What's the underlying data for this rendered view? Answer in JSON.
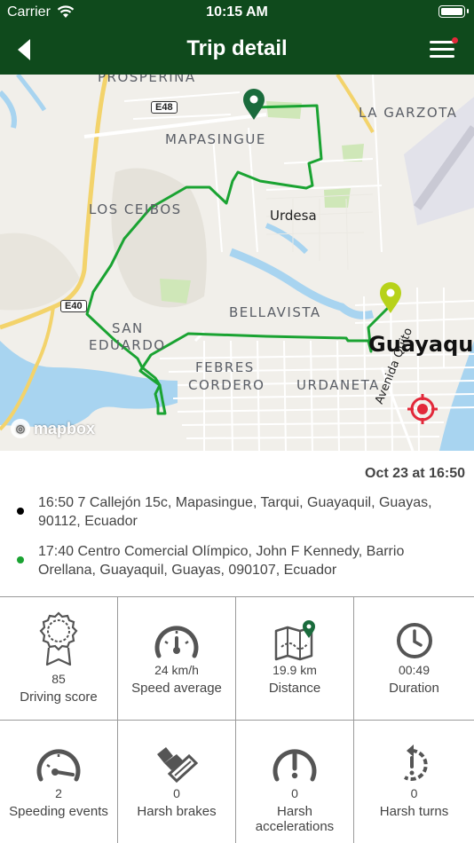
{
  "status_bar": {
    "carrier": "Carrier",
    "time": "10:15 AM"
  },
  "nav": {
    "title": "Trip detail"
  },
  "map": {
    "labels": {
      "prosperina": "PROSPERINA",
      "mapasingue": "MAPASINGUE",
      "la_garzota": "LA GARZOTA",
      "los_ceibos": "LOS CEIBOS",
      "urdesa": "Urdesa",
      "san": "SAN",
      "eduardo": "EDUARDO",
      "bellavista": "BELLAVISTA",
      "guayaquil": "Guayaquil",
      "febres": "FEBRES",
      "cordero": "CORDERO",
      "urdaneta": "URDANETA",
      "avenida_quito": "Avenida Quito"
    },
    "road_badges": {
      "e48": "E48",
      "e40": "E40"
    },
    "attribution": "mapbox",
    "colors": {
      "route": "#1aa332",
      "start_pin": "#1a6b3c",
      "end_pin": "#b7d21a",
      "target": "#e2293a",
      "water": "#a8d4f0"
    }
  },
  "trip": {
    "date": "Oct 23 at 16:50",
    "start": {
      "text": "16:50 7 Callejón 15c, Mapasingue, Tarqui, Guayaquil, Guayas, 90112, Ecuador",
      "dot_color": "#000000"
    },
    "end": {
      "text": "17:40 Centro Comercial Olímpico, John F Kennedy, Barrio Orellana, Guayaquil, Guayas, 090107, Ecuador",
      "dot_color": "#1aa332"
    }
  },
  "stats": [
    {
      "icon": "badge-icon",
      "value": "85",
      "label": "Driving score"
    },
    {
      "icon": "speedometer-icon",
      "value": "24 km/h",
      "label": "Speed average"
    },
    {
      "icon": "map-pin-icon",
      "value": "19.9 km",
      "label": "Distance"
    },
    {
      "icon": "clock-icon",
      "value": "00:49",
      "label": "Duration"
    },
    {
      "icon": "speeding-gauge-icon",
      "value": "2",
      "label": "Speeding events"
    },
    {
      "icon": "brake-pedal-icon",
      "value": "0",
      "label": "Harsh brakes"
    },
    {
      "icon": "acceleration-warning-icon",
      "value": "0",
      "label": "Harsh accelerations"
    },
    {
      "icon": "turn-arrow-icon",
      "value": "0",
      "label": "Harsh turns"
    }
  ]
}
